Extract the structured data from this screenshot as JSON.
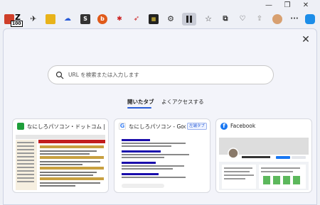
{
  "titlebar": {
    "minimize": "—",
    "restore": "❐",
    "close": "✕"
  },
  "toolbar": {
    "badge_100": "100",
    "icon_colors": {
      "yellow": "#e8b31a",
      "dark": "#333333",
      "orange": "#e05a1a",
      "red": "#cc2222",
      "blue": "#2a5dd8"
    }
  },
  "search": {
    "placeholder": "URL を検索または入力します"
  },
  "tabs": [
    {
      "label": "開いたタブ",
      "active": true
    },
    {
      "label": "よくアクセスする",
      "active": false
    }
  ],
  "cards": [
    {
      "title": "なにしろパソコン・ドットコム | マルチ...",
      "favicon_color": "#1e9e3a"
    },
    {
      "title": "なにしろパソコン - Goo...",
      "favicon_color": "#4285f4",
      "tag": "左端タブ"
    },
    {
      "title": "Facebook",
      "favicon_color": "#1877f2"
    }
  ],
  "panel": {
    "close": "✕"
  }
}
